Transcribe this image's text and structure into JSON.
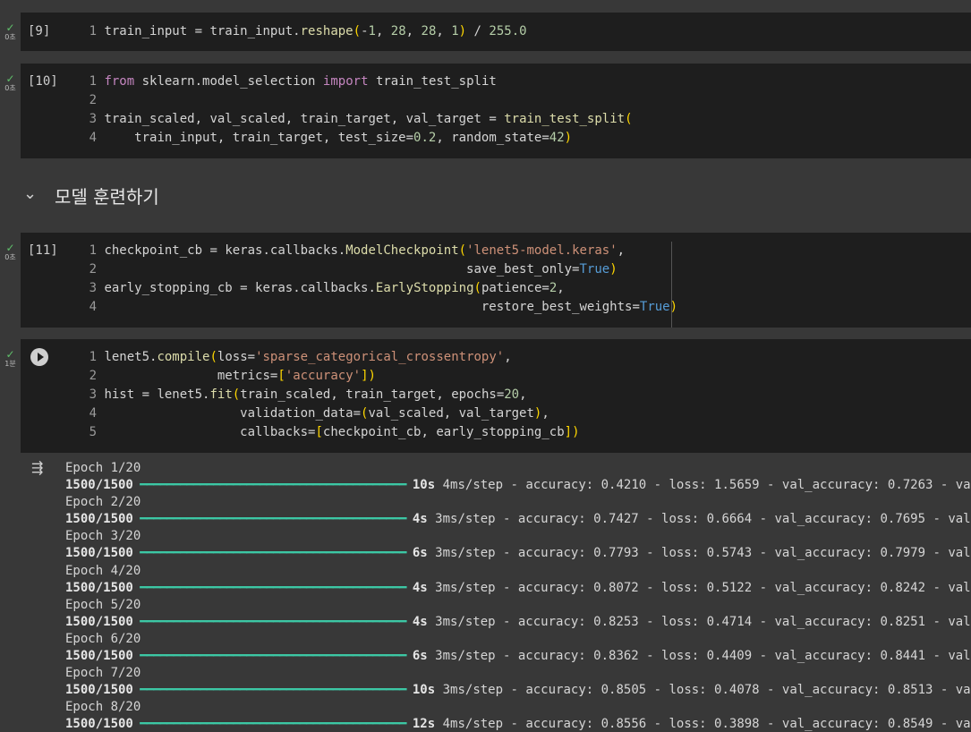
{
  "cells": [
    {
      "exec_count": "[9]",
      "exec_time": "0초",
      "lines": [
        {
          "n": "1",
          "text": "train_input = train_input.reshape(-1, 28, 28, 1) / 255.0"
        }
      ]
    },
    {
      "exec_count": "[10]",
      "exec_time": "0초",
      "lines": [
        {
          "n": "1",
          "text": "from sklearn.model_selection import train_test_split"
        },
        {
          "n": "2",
          "text": ""
        },
        {
          "n": "3",
          "text": "train_scaled, val_scaled, train_target, val_target = train_test_split("
        },
        {
          "n": "4",
          "text": "    train_input, train_target, test_size=0.2, random_state=42)"
        }
      ]
    },
    {
      "exec_count": "[11]",
      "exec_time": "0초",
      "lines": [
        {
          "n": "1",
          "text": "checkpoint_cb = keras.callbacks.ModelCheckpoint('lenet5-model.keras',"
        },
        {
          "n": "2",
          "text": "                                                save_best_only=True)"
        },
        {
          "n": "3",
          "text": "early_stopping_cb = keras.callbacks.EarlyStopping(patience=2,"
        },
        {
          "n": "4",
          "text": "                                                  restore_best_weights=True)"
        }
      ]
    },
    {
      "exec_count": "",
      "exec_time": "1분",
      "lines": [
        {
          "n": "1",
          "text": "lenet5.compile(loss='sparse_categorical_crossentropy',"
        },
        {
          "n": "2",
          "text": "               metrics=['accuracy'])"
        },
        {
          "n": "3",
          "text": "hist = lenet5.fit(train_scaled, train_target, epochs=20,"
        },
        {
          "n": "4",
          "text": "                  validation_data=(val_scaled, val_target),"
        },
        {
          "n": "5",
          "text": "                  callbacks=[checkpoint_cb, early_stopping_cb])"
        }
      ]
    }
  ],
  "section": {
    "title": "모델 훈련하기"
  },
  "output": {
    "epochs": [
      {
        "epoch": "Epoch 1/20",
        "steps": "1500/1500",
        "time": "10s",
        "rest": " 4ms/step - accuracy: 0.4210 - loss: 1.5659 - val_accuracy: 0.7263 - va"
      },
      {
        "epoch": "Epoch 2/20",
        "steps": "1500/1500",
        "time": "4s",
        "rest": " 3ms/step - accuracy: 0.7427 - loss: 0.6664 - val_accuracy: 0.7695 - val"
      },
      {
        "epoch": "Epoch 3/20",
        "steps": "1500/1500",
        "time": "6s",
        "rest": " 3ms/step - accuracy: 0.7793 - loss: 0.5743 - val_accuracy: 0.7979 - val"
      },
      {
        "epoch": "Epoch 4/20",
        "steps": "1500/1500",
        "time": "4s",
        "rest": " 3ms/step - accuracy: 0.8072 - loss: 0.5122 - val_accuracy: 0.8242 - val"
      },
      {
        "epoch": "Epoch 5/20",
        "steps": "1500/1500",
        "time": "4s",
        "rest": " 3ms/step - accuracy: 0.8253 - loss: 0.4714 - val_accuracy: 0.8251 - val"
      },
      {
        "epoch": "Epoch 6/20",
        "steps": "1500/1500",
        "time": "6s",
        "rest": " 3ms/step - accuracy: 0.8362 - loss: 0.4409 - val_accuracy: 0.8441 - val"
      },
      {
        "epoch": "Epoch 7/20",
        "steps": "1500/1500",
        "time": "10s",
        "rest": " 3ms/step - accuracy: 0.8505 - loss: 0.4078 - val_accuracy: 0.8513 - va"
      },
      {
        "epoch": "Epoch 8/20",
        "steps": "1500/1500",
        "time": "12s",
        "rest": " 4ms/step - accuracy: 0.8556 - loss: 0.3898 - val_accuracy: 0.8549 - va"
      }
    ]
  },
  "colors": {
    "cell_bg": "#1e1e1e",
    "page_bg": "#383838",
    "progress": "#3cc7a4",
    "check": "#5fbf6a"
  }
}
